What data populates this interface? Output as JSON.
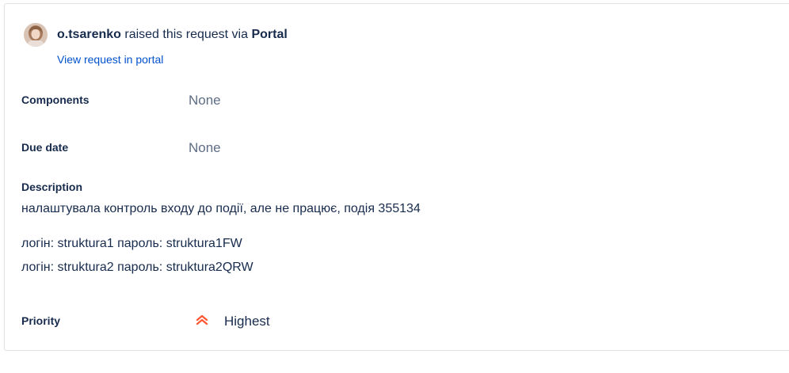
{
  "request": {
    "raiser_name": "o.tsarenko",
    "raised_text": " raised this request via ",
    "channel": "Portal",
    "portal_link": "View request in portal"
  },
  "fields": {
    "components_label": "Components",
    "components_value": "None",
    "due_date_label": "Due date",
    "due_date_value": "None",
    "description_label": "Description",
    "description_lines": [
      "налаштувала контроль входу до події, але не працює, подія 355134",
      "логін: struktura1 пароль: struktura1FW",
      "логін: struktura2 пароль: struktura2QRW"
    ],
    "priority_label": "Priority",
    "priority_value": "Highest",
    "priority_icon": "chevron-double-up-icon",
    "priority_color": "#ff5630"
  },
  "colors": {
    "link": "#0052cc",
    "text": "#172b4d",
    "muted": "#5e6c84",
    "border": "#dfe1e6"
  }
}
